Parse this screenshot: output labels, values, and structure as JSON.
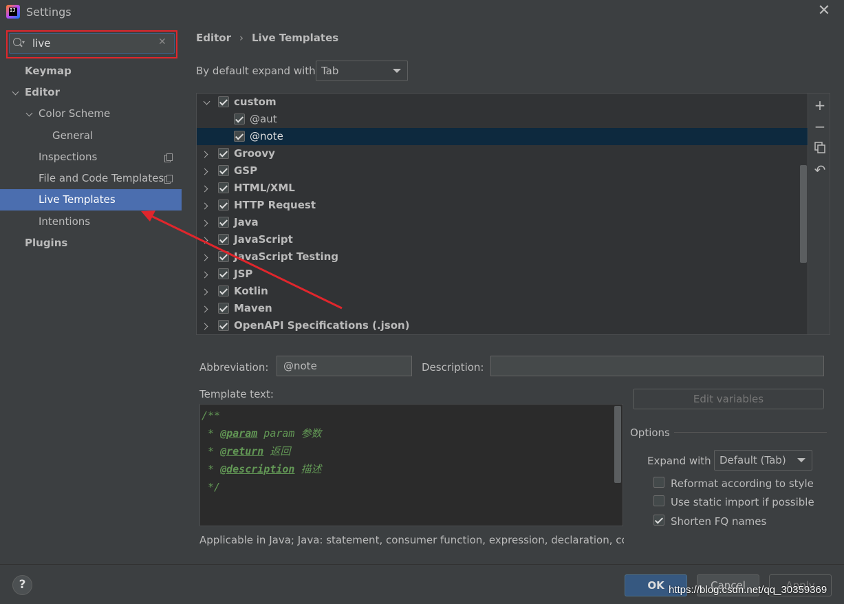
{
  "window": {
    "title": "Settings"
  },
  "search": {
    "value": "live"
  },
  "nav": {
    "items": [
      {
        "label": "Keymap"
      },
      {
        "label": "Editor"
      },
      {
        "label": "Color Scheme"
      },
      {
        "label": "General"
      },
      {
        "label": "Inspections"
      },
      {
        "label": "File and Code Templates"
      },
      {
        "label": "Live Templates"
      },
      {
        "label": "Intentions"
      },
      {
        "label": "Plugins"
      }
    ]
  },
  "breadcrumb": {
    "parent": "Editor",
    "separator": "›",
    "current": "Live Templates"
  },
  "expand_default": {
    "label": "By default expand with",
    "value": "Tab"
  },
  "tree": {
    "rows": [
      {
        "label": "custom",
        "checked": true
      },
      {
        "label": "@aut",
        "checked": true
      },
      {
        "label": "@note",
        "checked": true
      },
      {
        "label": "Groovy",
        "checked": true
      },
      {
        "label": "GSP",
        "checked": true
      },
      {
        "label": "HTML/XML",
        "checked": true
      },
      {
        "label": "HTTP Request",
        "checked": true
      },
      {
        "label": "Java",
        "checked": true
      },
      {
        "label": "JavaScript",
        "checked": true
      },
      {
        "label": "JavaScript Testing",
        "checked": true
      },
      {
        "label": "JSP",
        "checked": true
      },
      {
        "label": "Kotlin",
        "checked": true
      },
      {
        "label": "Maven",
        "checked": true
      },
      {
        "label": "OpenAPI Specifications (.json)",
        "checked": true
      }
    ],
    "tools": {
      "add": "+",
      "remove": "−",
      "copy": "copy-icon",
      "restore": "↶"
    }
  },
  "editor": {
    "abbreviation_label": "Abbreviation:",
    "abbreviation_value": "@note",
    "description_label": "Description:",
    "description_value": "",
    "template_label": "Template text:",
    "code": [
      {
        "prefix": "/**",
        "tag": "",
        "rest": ""
      },
      {
        "prefix": " * ",
        "tag": "@param",
        "rest": " param 参数"
      },
      {
        "prefix": " * ",
        "tag": "@return",
        "rest": " 返回"
      },
      {
        "prefix": " * ",
        "tag": "@description",
        "rest": " 描述"
      },
      {
        "prefix": " */",
        "tag": "",
        "rest": ""
      }
    ],
    "applicable": "Applicable in Java; Java: statement, consumer function, expression, declaration, comr",
    "edit_variables": "Edit variables"
  },
  "options": {
    "title": "Options",
    "expand_with_label": "Expand with",
    "expand_with_value": "Default (Tab)",
    "reformat": {
      "label": "Reformat according to style",
      "checked": false
    },
    "static_import": {
      "label": "Use static import if possible",
      "checked": false
    },
    "shorten_fq": {
      "label": "Shorten FQ names",
      "checked": true
    }
  },
  "footer": {
    "help": "?",
    "ok": "OK",
    "cancel": "Cancel",
    "apply": "Apply",
    "watermark": "https://blog.csdn.net/qq_30359369"
  },
  "colors": {
    "background": "#3c3f41",
    "selection": "#4b6eaf",
    "tree_selection": "#0d293e",
    "annotation_red": "#e0262c",
    "doc_comment": "#629755"
  }
}
